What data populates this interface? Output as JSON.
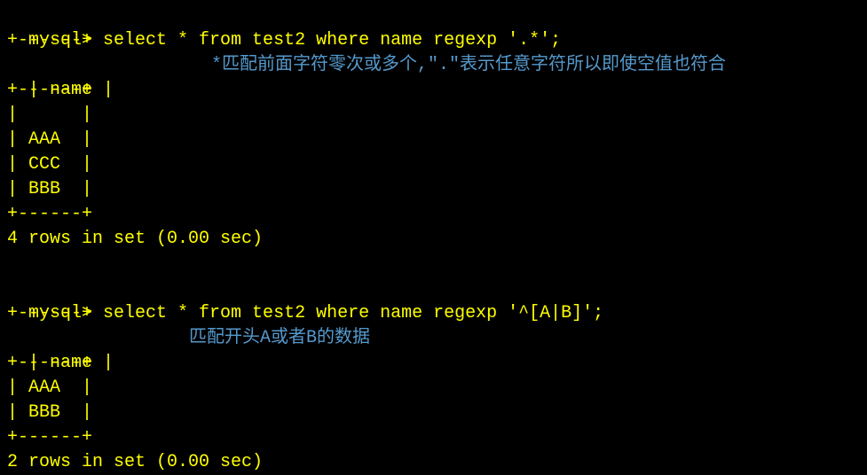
{
  "query1": {
    "prompt": "mysql> ",
    "sql": "select * from test2 where name regexp '.*';",
    "divider": "+------+",
    "header": "| name |",
    "rows": [
      "|      |",
      "| AAA  |",
      "| CCC  |",
      "| BBB  |"
    ],
    "result": "4 rows in set (0.00 sec)",
    "annotation": "*匹配前面字符零次或多个,\".\"表示任意字符所以即使空值也符合"
  },
  "query2": {
    "prompt": "mysql> ",
    "sql": "select * from test2 where name regexp '^[A|B]';",
    "divider": "+------+",
    "header": "| name |",
    "rows": [
      "| AAA  |",
      "| BBB  |"
    ],
    "result": "2 rows in set (0.00 sec)",
    "annotation": "匹配开头A或者B的数据"
  }
}
